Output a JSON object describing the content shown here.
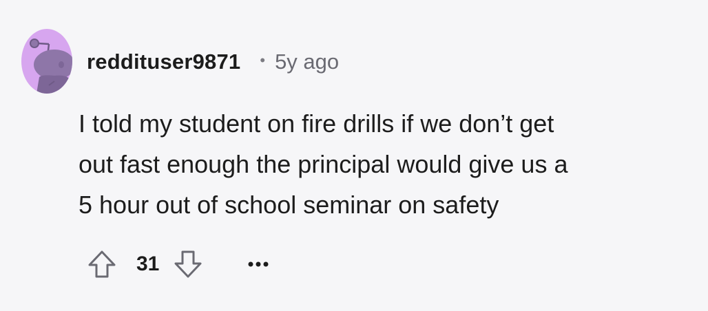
{
  "comment": {
    "username": "reddituser9871",
    "separator": "•",
    "timestamp": "5y ago",
    "text": "I told my student on fire drills if we don’t get\nout fast enough the principal would give us a\n5 hour out of school seminar on safety",
    "score": "31",
    "more_label": "•••",
    "avatar_icon": "snoo-avatar-icon",
    "upvote_icon": "arrow-up-icon",
    "downvote_icon": "arrow-down-icon",
    "colors": {
      "avatar_bg": "#d7a6ef",
      "avatar_figure": "#8e76a8",
      "text": "#1c1c1c",
      "muted": "#6a6a72",
      "background": "#f6f6f8"
    }
  }
}
